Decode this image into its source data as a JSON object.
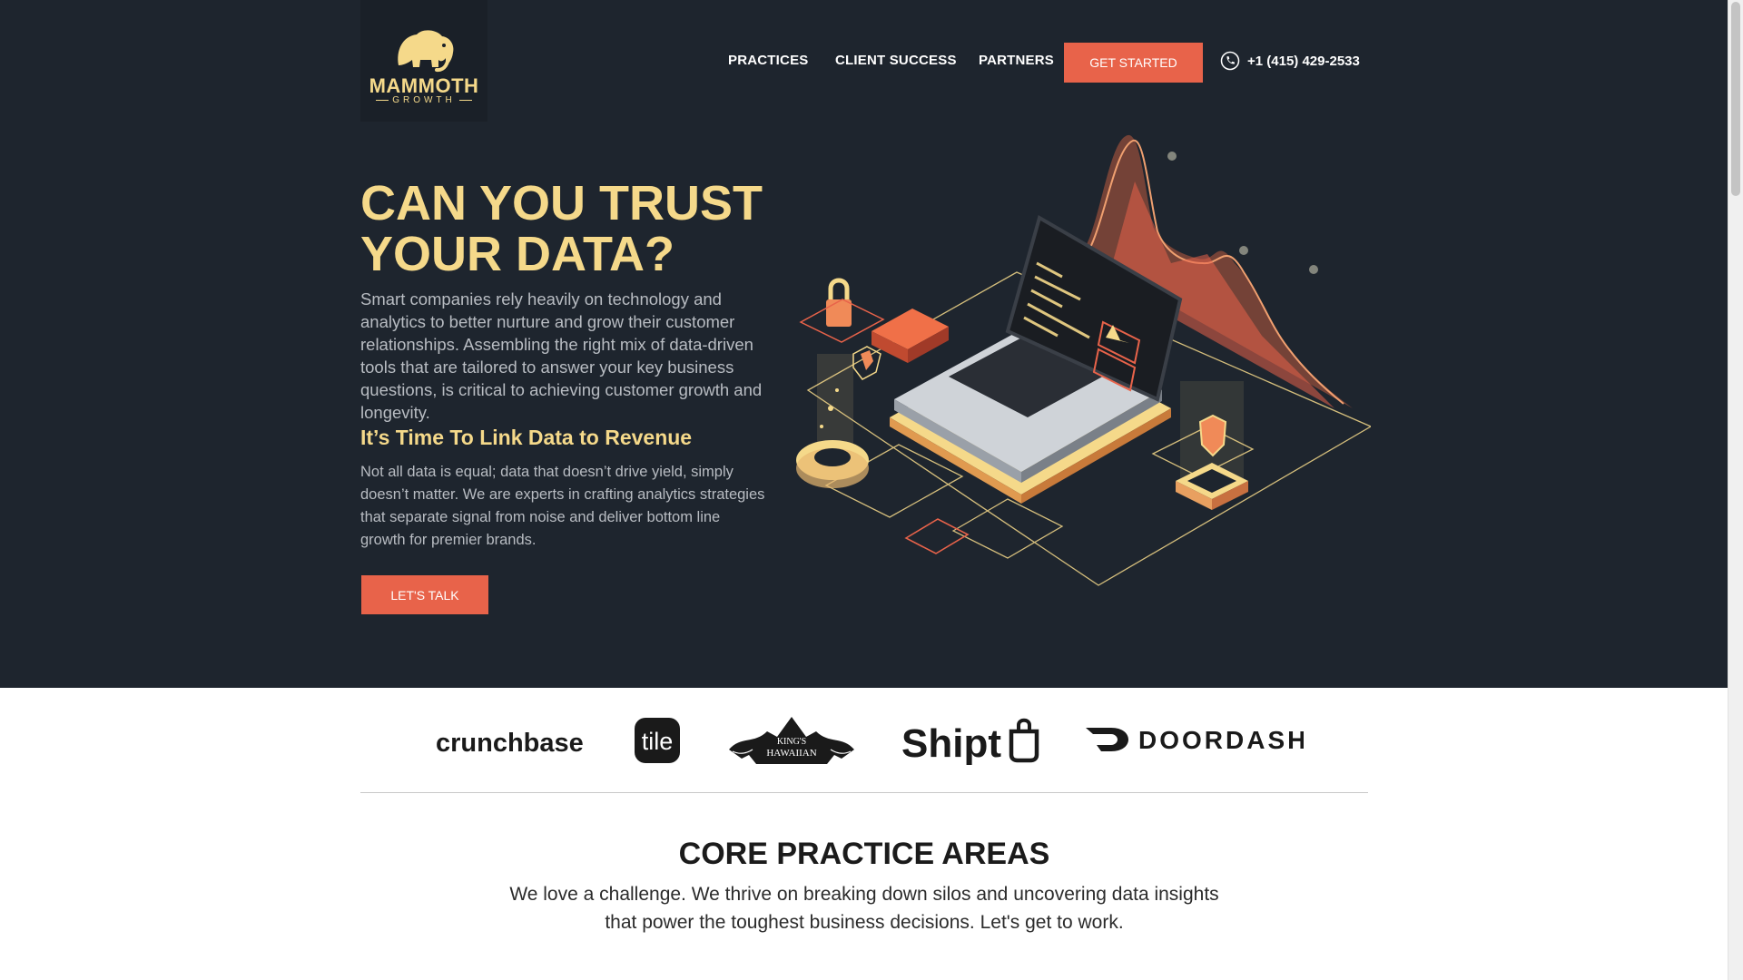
{
  "colors": {
    "hero_bg": "#1e252e",
    "accent": "#e8634a",
    "gold": "#f5d98a",
    "muted_text": "#b8bcc2"
  },
  "logo": {
    "name": "MAMMOTH",
    "sub": "GROWTH",
    "icon": "mammoth-icon"
  },
  "nav": {
    "items": [
      "PRACTICES",
      "CLIENT SUCCESS",
      "PARTNERS"
    ],
    "cta": "GET STARTED",
    "phone": "+1 (415) 429-2533",
    "phone_icon": "phone-icon"
  },
  "hero": {
    "headline_1": "CAN YOU TRUST",
    "headline_2": "YOUR DATA?",
    "intro": "Smart companies rely heavily on technology and analytics to better nurture and grow their customer relationships. Assembling the right mix of data-driven tools that are tailored to answer your key business questions, is critical to achieving customer growth and longevity.",
    "subhead": "It’s Time To Link Data to Revenue",
    "body": "Not all data is equal; data that doesn’t drive yield, simply doesn’t matter. We are experts in crafting analytics strategies that separate signal from noise and deliver bottom line growth for premier brands.",
    "cta": "LET'S TALK"
  },
  "clients": {
    "crunchbase": "crunchbase",
    "tile": "tile",
    "kings_hawaiian_1": "KING'S",
    "kings_hawaiian_2": "HAWAIIAN",
    "shipt": "Shipt",
    "doordash": "DOORDASH"
  },
  "core": {
    "title": "CORE PRACTICE AREAS",
    "text": "We love a challenge. We thrive on breaking down silos and uncovering data insights that power the toughest business decisions. Let's get to work."
  }
}
